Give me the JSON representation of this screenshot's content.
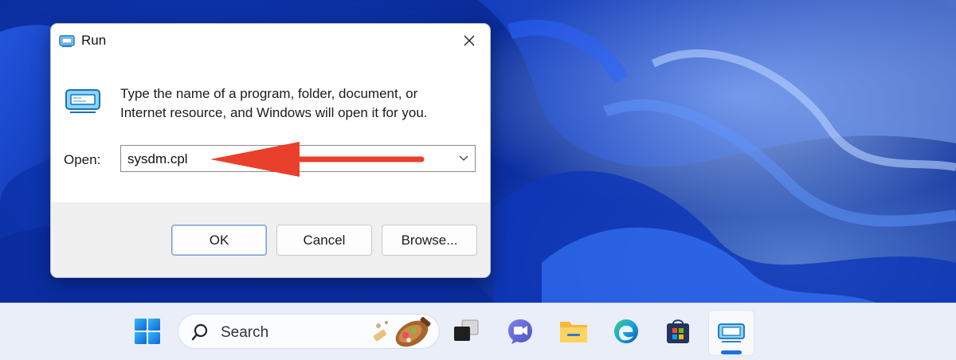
{
  "dialog": {
    "title": "Run",
    "description_line1": "Type the name of a program, folder, document, or",
    "description_line2": "Internet resource, and Windows will open it for you.",
    "open_label": "Open:",
    "open_value": "sysdm.cpl",
    "buttons": {
      "ok": "OK",
      "cancel": "Cancel",
      "browse": "Browse..."
    },
    "icons": {
      "title": "run-app-icon",
      "main": "run-app-icon",
      "close": "close-icon",
      "dropdown": "chevron-down-icon"
    }
  },
  "annotation": {
    "arrow_color": "#e8402b"
  },
  "taskbar": {
    "search_placeholder": "Search",
    "items": [
      {
        "name": "start",
        "icon": "windows-logo-icon"
      },
      {
        "name": "search",
        "icon": "search-icon"
      },
      {
        "name": "task-view",
        "icon": "task-view-icon"
      },
      {
        "name": "teams-chat",
        "icon": "teams-icon"
      },
      {
        "name": "file-explorer",
        "icon": "folder-icon"
      },
      {
        "name": "edge",
        "icon": "edge-icon"
      },
      {
        "name": "microsoft-store",
        "icon": "store-icon"
      },
      {
        "name": "run",
        "icon": "run-app-icon",
        "active": true
      }
    ],
    "accent_color": "#1f6fe0"
  }
}
